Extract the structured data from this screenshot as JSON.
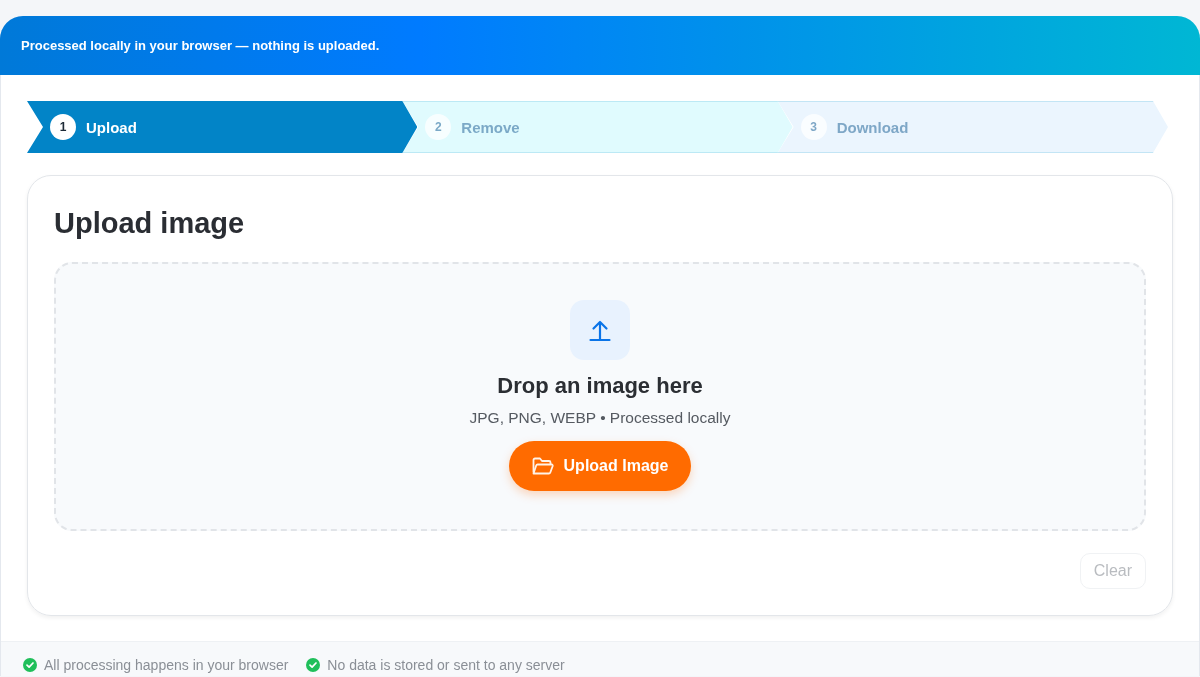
{
  "banner": {
    "text": "Processed locally in your browser — nothing is uploaded."
  },
  "steps": [
    {
      "number": "1",
      "label": "Upload",
      "selected": true,
      "color": "#0284c7"
    },
    {
      "number": "2",
      "label": "Remove",
      "selected": false,
      "color": "#e0fbfe"
    },
    {
      "number": "3",
      "label": "Download",
      "selected": false,
      "color": "#ebf5fe"
    }
  ],
  "card": {
    "title": "Upload image",
    "dropzone": {
      "heading": "Drop an image here",
      "hint": "JPG, PNG, WEBP • Processed locally",
      "button": "Upload Image"
    },
    "clear_button": {
      "label": "Clear",
      "disabled": true
    }
  },
  "footer": {
    "items": [
      "All processing happens in your browser",
      "No data is stored or sent to any server"
    ]
  }
}
